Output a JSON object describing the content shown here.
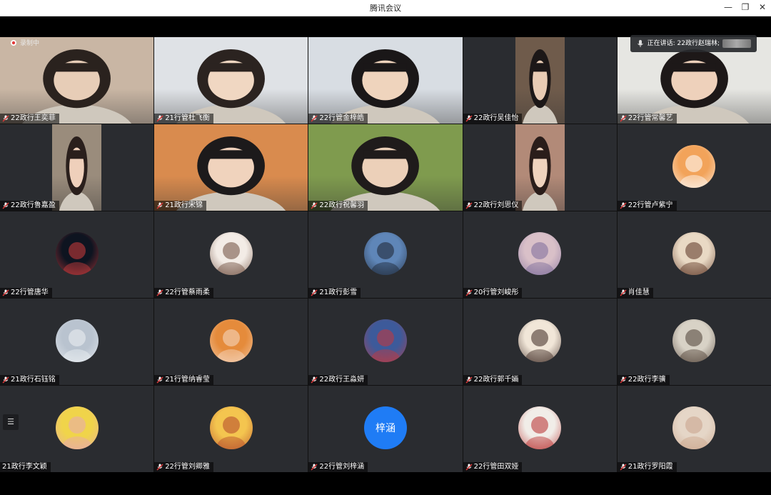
{
  "window": {
    "title": "腾讯会议",
    "minimize": "—",
    "restore": "❐",
    "close": "✕"
  },
  "status": {
    "recording": "录制中",
    "speaking": "正在讲话: 22政行赵瑞林;"
  },
  "colors": {
    "tile_bg": "#2a2c30",
    "accent_blue": "#1f7cf5",
    "mic_red": "#e23b3b"
  },
  "participants": [
    {
      "name": "22政行王奕菲",
      "kind": "video",
      "bg": "#c9b6a4",
      "face": "#e7cdb7",
      "hair": "#2a221e"
    },
    {
      "name": "21行管杜飞衡",
      "kind": "video",
      "bg": "#dfe2e6",
      "face": "#f0d7c2",
      "hair": "#2b2320"
    },
    {
      "name": "22行管金梓皓",
      "kind": "video",
      "bg": "#d8dde3",
      "face": "#efd4bd",
      "hair": "#1a1718"
    },
    {
      "name": "22政行吴佳怡",
      "kind": "video",
      "bg": "#6f5b4b",
      "face": "#e8cbb4",
      "hair": "#1c1717"
    },
    {
      "name": "22行管常馨艺",
      "kind": "video",
      "bg": "#e6e6e2",
      "face": "#eed1bb",
      "hair": "#1d1818"
    },
    {
      "name": "22政行鲁嘉盈",
      "kind": "video",
      "bg": "#9a8c7c",
      "face": "#efd0bb",
      "hair": "#2a1f1c"
    },
    {
      "name": "21政行宋锦",
      "kind": "video",
      "bg": "#d98b4e",
      "face": "#f0d3bd",
      "hair": "#1c1a1b"
    },
    {
      "name": "22政行祝馨羽",
      "kind": "video",
      "bg": "#7f9b4e",
      "face": "#ecd0b9",
      "hair": "#1f1b1b"
    },
    {
      "name": "22政行刘思仪",
      "kind": "video",
      "bg": "#b28a78",
      "face": "#efd3be",
      "hair": "#2a1d1a"
    },
    {
      "name": "22行管卢紫宁",
      "kind": "avatar",
      "avatar": "puppy-avatar",
      "c1": "#f2a35a",
      "c2": "#ffffff"
    },
    {
      "name": "22行管唐华",
      "kind": "avatar",
      "avatar": "balloon-avatar",
      "c1": "#0e1420",
      "c2": "#d13d3d"
    },
    {
      "name": "22行管蔡雨柔",
      "kind": "avatar",
      "avatar": "anime-girl-avatar",
      "c1": "#f3ece6",
      "c2": "#6b4a3a"
    },
    {
      "name": "21政行彭雪",
      "kind": "avatar",
      "avatar": "sky-silhouette-avatar",
      "c1": "#5f86b8",
      "c2": "#1b2330"
    },
    {
      "name": "20行管刘峻彤",
      "kind": "avatar",
      "avatar": "cartoon-pattern-avatar",
      "c1": "#d9c0c8",
      "c2": "#7b6a9a"
    },
    {
      "name": "肖佳慧",
      "kind": "avatar",
      "avatar": "lilo-avatar",
      "c1": "#e9d9c4",
      "c2": "#5a3222"
    },
    {
      "name": "21政行石钰铭",
      "kind": "avatar",
      "avatar": "cloud-avatar",
      "c1": "#b9c3cf",
      "c2": "#eef1f4"
    },
    {
      "name": "21行管纳睿莹",
      "kind": "avatar",
      "avatar": "tiger-hat-avatar",
      "c1": "#e58b3b",
      "c2": "#f6dcc8"
    },
    {
      "name": "22政行王淼妍",
      "kind": "avatar",
      "avatar": "costume-girl-avatar",
      "c1": "#3d5a9a",
      "c2": "#c9373a"
    },
    {
      "name": "22政行郭千婳",
      "kind": "avatar",
      "avatar": "chibi-avatar",
      "c1": "#f1e6d8",
      "c2": "#3a2620"
    },
    {
      "name": "22政行李骥",
      "kind": "avatar",
      "avatar": "sketch-boy-avatar",
      "c1": "#d8d2c6",
      "c2": "#4d3e34"
    },
    {
      "name": "21政行李文颖",
      "kind": "avatar",
      "avatar": "spongebob-avatar",
      "c1": "#f0d44a",
      "c2": "#e7a7b4",
      "nomic": true
    },
    {
      "name": "22行管刘卿雅",
      "kind": "avatar",
      "avatar": "plush-doll-avatar",
      "c1": "#f4c54f",
      "c2": "#b3462b"
    },
    {
      "name": "22行管刘梓涵",
      "kind": "text-avatar",
      "initials": "梓涵"
    },
    {
      "name": "22行管田双娅",
      "kind": "avatar",
      "avatar": "hanfu-girl-avatar",
      "c1": "#f1ede8",
      "c2": "#b72b2b"
    },
    {
      "name": "21政行罗阳霞",
      "kind": "avatar",
      "avatar": "photo-girl-avatar",
      "c1": "#e5d6c7",
      "c2": "#c9a38a"
    }
  ]
}
